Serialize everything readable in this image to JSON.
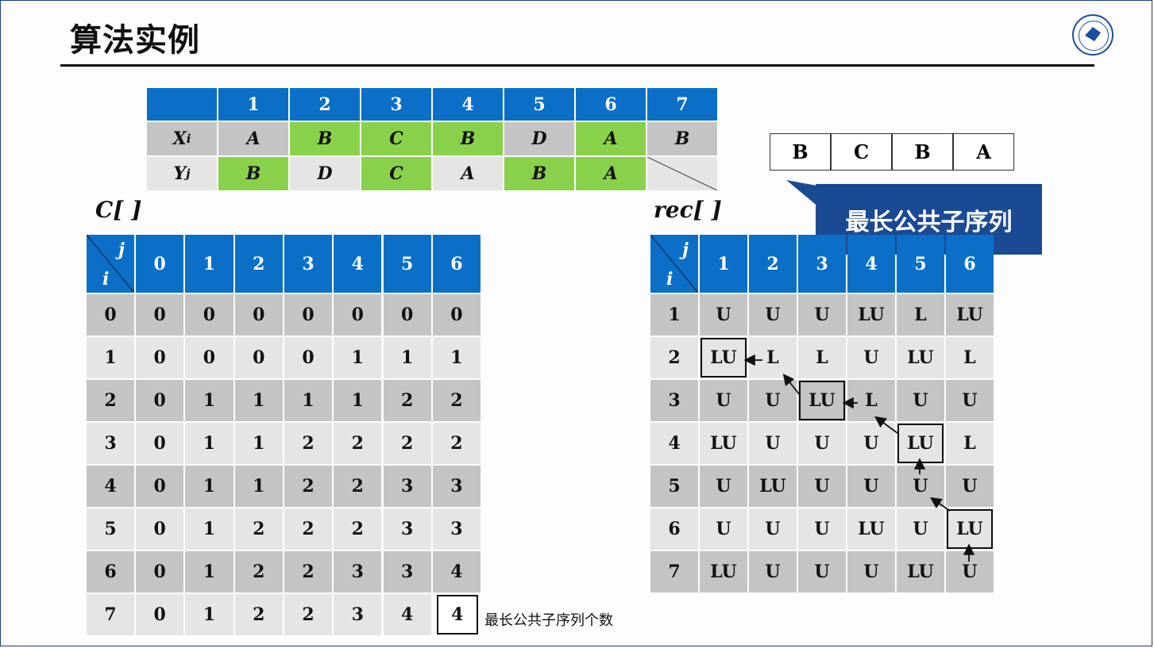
{
  "page": {
    "title": "算法实例"
  },
  "seq_table": {
    "col_headers": [
      "1",
      "2",
      "3",
      "4",
      "5",
      "6",
      "7"
    ],
    "x_label": "X",
    "x_sub": "i",
    "y_label": "Y",
    "y_sub": "j",
    "x_values": [
      "A",
      "B",
      "C",
      "B",
      "D",
      "A",
      "B"
    ],
    "y_values": [
      "B",
      "D",
      "C",
      "A",
      "B",
      "A",
      ""
    ]
  },
  "lcs_result": {
    "sequence": [
      "B",
      "C",
      "B",
      "A"
    ],
    "callout": "最长公共子序列"
  },
  "c_table": {
    "label": "C[ ]",
    "corner_j": "j",
    "corner_i": "i",
    "col_headers": [
      "0",
      "1",
      "2",
      "3",
      "4",
      "5",
      "6"
    ],
    "rows": [
      [
        "0",
        "0",
        "0",
        "0",
        "0",
        "0",
        "0",
        "0"
      ],
      [
        "1",
        "0",
        "0",
        "0",
        "0",
        "1",
        "1",
        "1"
      ],
      [
        "2",
        "0",
        "1",
        "1",
        "1",
        "1",
        "2",
        "2"
      ],
      [
        "3",
        "0",
        "1",
        "1",
        "2",
        "2",
        "2",
        "2"
      ],
      [
        "4",
        "0",
        "1",
        "1",
        "2",
        "2",
        "3",
        "3"
      ],
      [
        "5",
        "0",
        "1",
        "2",
        "2",
        "2",
        "3",
        "3"
      ],
      [
        "6",
        "0",
        "1",
        "2",
        "2",
        "3",
        "3",
        "4"
      ],
      [
        "7",
        "0",
        "1",
        "2",
        "2",
        "3",
        "4",
        "4"
      ]
    ],
    "note": "最长公共子序列个数"
  },
  "rec_table": {
    "label": "rec[ ]",
    "corner_j": "j",
    "corner_i": "i",
    "col_headers": [
      "1",
      "2",
      "3",
      "4",
      "5",
      "6"
    ],
    "rows": [
      [
        "1",
        "U",
        "U",
        "U",
        "LU",
        "L",
        "LU"
      ],
      [
        "2",
        "LU",
        "L",
        "L",
        "U",
        "LU",
        "L"
      ],
      [
        "3",
        "U",
        "U",
        "LU",
        "L",
        "U",
        "U"
      ],
      [
        "4",
        "LU",
        "U",
        "U",
        "U",
        "LU",
        "L"
      ],
      [
        "5",
        "U",
        "LU",
        "U",
        "U",
        "U",
        "U"
      ],
      [
        "6",
        "U",
        "U",
        "U",
        "LU",
        "U",
        "LU"
      ],
      [
        "7",
        "LU",
        "U",
        "U",
        "U",
        "LU",
        "U"
      ]
    ]
  }
}
